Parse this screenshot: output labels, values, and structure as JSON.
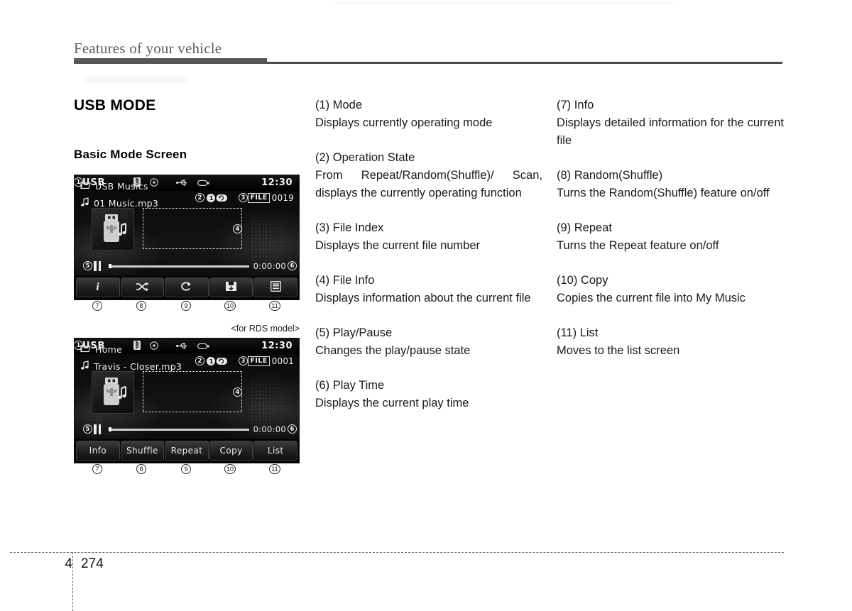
{
  "header": {
    "title": "Features of your vehicle"
  },
  "section": {
    "title": "USB MODE",
    "subtitle": "Basic Mode Screen",
    "rds_note": "<for RDS model>"
  },
  "screens": [
    {
      "name": "basic-mode-screen",
      "status": {
        "mode": "USB",
        "time": "12:30",
        "icons": [
          "bluetooth-icon",
          "disc-icon",
          "usb-icon",
          "battery-icon"
        ]
      },
      "operation_state": {
        "repeat_number": "1",
        "icon": "repeat-icon"
      },
      "file_index": {
        "tag": "FILE",
        "number": "0019"
      },
      "file_info": {
        "folder": "USB Musics",
        "track": "01 Music.mp3"
      },
      "transport": {
        "state_icon": "pause-icon",
        "play_time": "0:00:00",
        "progress_percent": 0
      },
      "buttons": [
        {
          "label": "i",
          "icon": "info-icon",
          "type": "icon"
        },
        {
          "label": "",
          "icon": "shuffle-icon",
          "type": "icon"
        },
        {
          "label": "",
          "icon": "repeat-icon",
          "type": "icon"
        },
        {
          "label": "",
          "icon": "copy-icon",
          "type": "icon"
        },
        {
          "label": "",
          "icon": "list-icon",
          "type": "icon"
        }
      ],
      "callouts": [
        "1",
        "2",
        "3",
        "4",
        "5",
        "6"
      ],
      "button_callouts": [
        "7",
        "8",
        "9",
        "10",
        "11"
      ]
    },
    {
      "name": "rds-mode-screen",
      "status": {
        "mode": "USB",
        "time": "12:30",
        "icons": [
          "bluetooth-icon",
          "disc-icon",
          "usb-icon",
          "battery-icon"
        ]
      },
      "operation_state": {
        "repeat_number": "1",
        "icon": "repeat-icon"
      },
      "file_index": {
        "tag": "FILE",
        "number": "0001"
      },
      "file_info": {
        "folder": "Home",
        "track": "Travis - Closer.mp3"
      },
      "transport": {
        "state_icon": "pause-icon",
        "play_time": "0:00:00",
        "progress_percent": 0
      },
      "buttons": [
        {
          "label": "Info",
          "icon": "info-icon",
          "type": "text"
        },
        {
          "label": "Shuffle",
          "icon": "shuffle-icon",
          "type": "text"
        },
        {
          "label": "Repeat",
          "icon": "repeat-icon",
          "type": "text"
        },
        {
          "label": "Copy",
          "icon": "copy-icon",
          "type": "text"
        },
        {
          "label": "List",
          "icon": "list-icon",
          "type": "text"
        }
      ],
      "callouts": [
        "1",
        "2",
        "3",
        "4",
        "5",
        "6"
      ],
      "button_callouts": [
        "7",
        "8",
        "9",
        "10",
        "11"
      ]
    }
  ],
  "descriptions": {
    "mid": [
      {
        "title": "(1) Mode",
        "desc": "Displays currently operating mode"
      },
      {
        "title": "(2) Operation State",
        "desc": "From Repeat/Random(Shuffle)/ Scan, displays the currently operating function"
      },
      {
        "title": "(3) File Index",
        "desc": "Displays the current file number"
      },
      {
        "title": "(4) File Info",
        "desc": "Displays information about the current file"
      },
      {
        "title": "(5) Play/Pause",
        "desc": "Changes the play/pause state"
      },
      {
        "title": "(6) Play Time",
        "desc": "Displays the current play time"
      }
    ],
    "right": [
      {
        "title": "(7) Info",
        "desc": "Displays detailed information for the current file"
      },
      {
        "title": "(8) Random(Shuffle)",
        "desc": "Turns the Random(Shuffle) feature on/off"
      },
      {
        "title": "(9) Repeat",
        "desc": "Turns the Repeat feature on/off"
      },
      {
        "title": "(10) Copy",
        "desc": "Copies the current file into My Music"
      },
      {
        "title": "(11) List",
        "desc": "Moves to the list screen"
      }
    ]
  },
  "footer": {
    "chapter": "4",
    "page": "274"
  },
  "colors": {
    "rule": "#565656",
    "screen_bg": "#000000",
    "screen_text": "#f2f2f2"
  }
}
